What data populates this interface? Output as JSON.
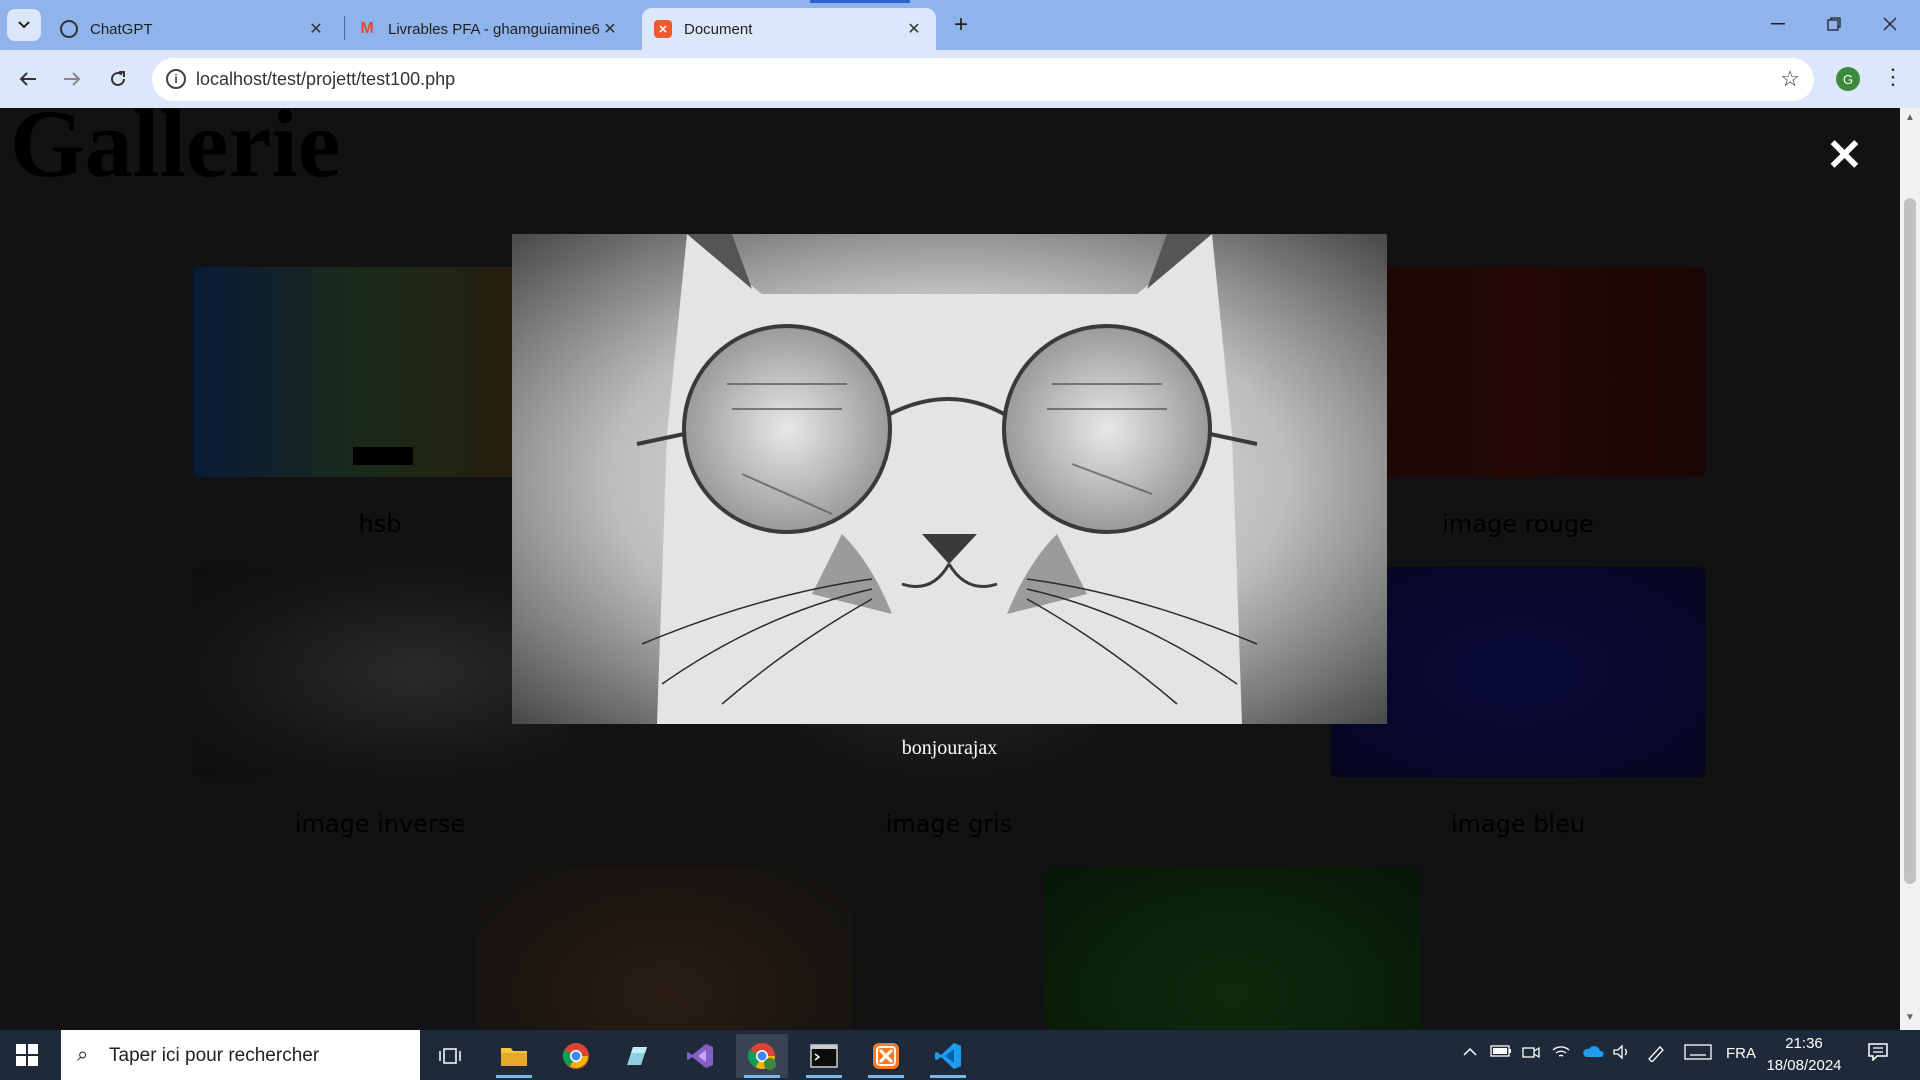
{
  "browser": {
    "tabs": [
      {
        "title": "ChatGPT"
      },
      {
        "title": "Livrables PFA - ghamguiamine6"
      },
      {
        "title": "Document"
      }
    ],
    "url": "localhost/test/projett/test100.php",
    "profile_initial": "G"
  },
  "page": {
    "title": "Gallerie",
    "gallery": [
      {
        "label": "hsb"
      },
      {
        "label": "image rouge"
      },
      {
        "label": "image inverse"
      },
      {
        "label": "image gris"
      },
      {
        "label": "image bleu"
      }
    ],
    "modal": {
      "close_glyph": "✕",
      "caption": "bonjourajax"
    }
  },
  "taskbar": {
    "search_placeholder": "Taper ici pour rechercher",
    "language": "FRA",
    "time": "21:36",
    "date": "18/08/2024"
  },
  "colors": {
    "tabbar": "#8fb4ec",
    "toolbar": "#dce7fb",
    "page_overlay": "#121212",
    "taskbar": "#1e2a3a"
  }
}
